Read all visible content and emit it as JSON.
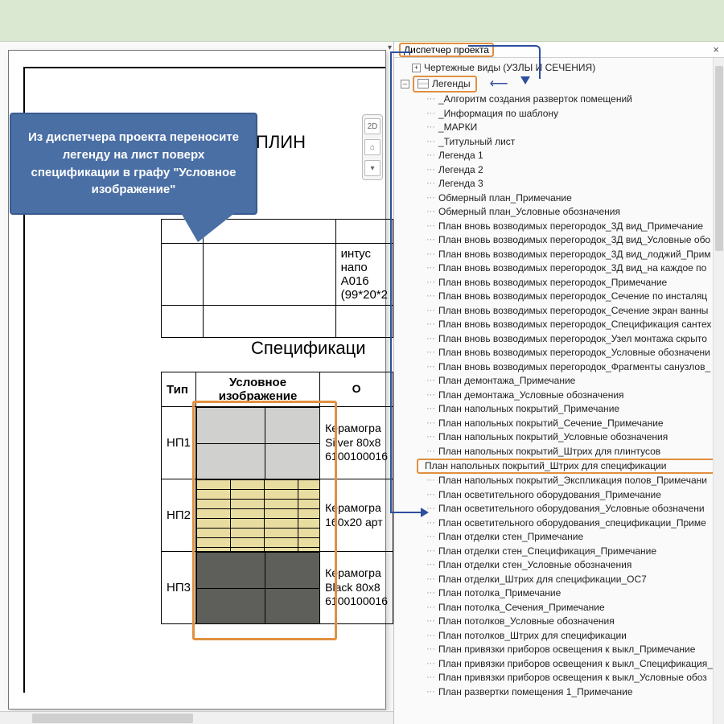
{
  "browser": {
    "title": "Диспетчер проекта",
    "top_node": "Чертежные виды (УЗЛЫ И СЕЧЕНИЯ)",
    "legends_label": "Легенды",
    "highlighted_item": "План напольных покрытий_Штрих для спецификации",
    "items": [
      "_Алгоритм создания разверток помещений",
      "_Информация по шаблону",
      "_МАРКИ",
      "_Титульный лист",
      "Легенда 1",
      "Легенда 2",
      "Легенда 3",
      "Обмерный план_Примечание",
      "Обмерный план_Условные обозначения",
      "План вновь возводимых перегородок_3Д вид_Примечание",
      "План вновь возводимых перегородок_3Д вид_Условные обо",
      "План вновь возводимых перегородок_3Д вид_лоджий_Прим",
      "План вновь возводимых перегородок_3Д вид_на каждое по",
      "План вновь возводимых перегородок_Примечание",
      "План вновь возводимых перегородок_Сечение по инсталяц",
      "План вновь возводимых перегородок_Сечение экран ванны",
      "План вновь возводимых перегородок_Спецификация сантех",
      "План вновь возводимых перегородок_Узел монтажа скрыто",
      "План вновь возводимых перегородок_Условные обозначени",
      "План вновь возводимых перегородок_Фрагменты санузлов_",
      "План демонтажа_Примечание",
      "План демонтажа_Условные обозначения",
      "План напольных покрытий_Примечание",
      "План напольных покрытий_Сечение_Примечание",
      "План напольных покрытий_Условные обозначения",
      "План напольных покрытий_Штрих для плинтусов",
      "__HIGHLIGHT__",
      "План напольных покрытий_Экспликация полов_Примечани",
      "План осветительного оборудования_Примечание",
      "План осветительного оборудования_Условные обозначени",
      "План осветительного оборудования_спецификации_Приме",
      "План отделки стен_Примечание",
      "План отделки стен_Спецификация_Примечание",
      "План отделки стен_Условные обозначения",
      "План отделки_Штрих для спецификации_ОС7",
      "План потолка_Примечание",
      "План потолка_Сечения_Примечание",
      "План потолков_Условные обозначения",
      "План потолков_Штрих для спецификации",
      "План привязки приборов освещения к выкл_Примечание",
      "План привязки приборов освещения к выкл_Спецификация_",
      "План привязки приборов освещения к выкл_Условные обоз",
      "План развертки помещения 1_Примечание"
    ]
  },
  "callout": {
    "text": "Из диспетчера проекта переносите легенду на лист поверх спецификации в графу \"Условное изображение\""
  },
  "canvas": {
    "title_fragment": "ПЛИН",
    "table1_note": "инτус напо",
    "table1_code": "A016 (99*20*2",
    "spec_title": "Спецификаци",
    "header_type": "Тип",
    "header_img": "Условное изображение",
    "header_o": "О",
    "rows": [
      {
        "type": "НП1",
        "desc": "Керамогра\nSilver 80x8\n6100100016"
      },
      {
        "type": "НП2",
        "desc": "Керамогра\n160x20 арт"
      },
      {
        "type": "НП3",
        "desc": "Керамогра\nBlack 80x8\n6100100016"
      }
    ]
  }
}
